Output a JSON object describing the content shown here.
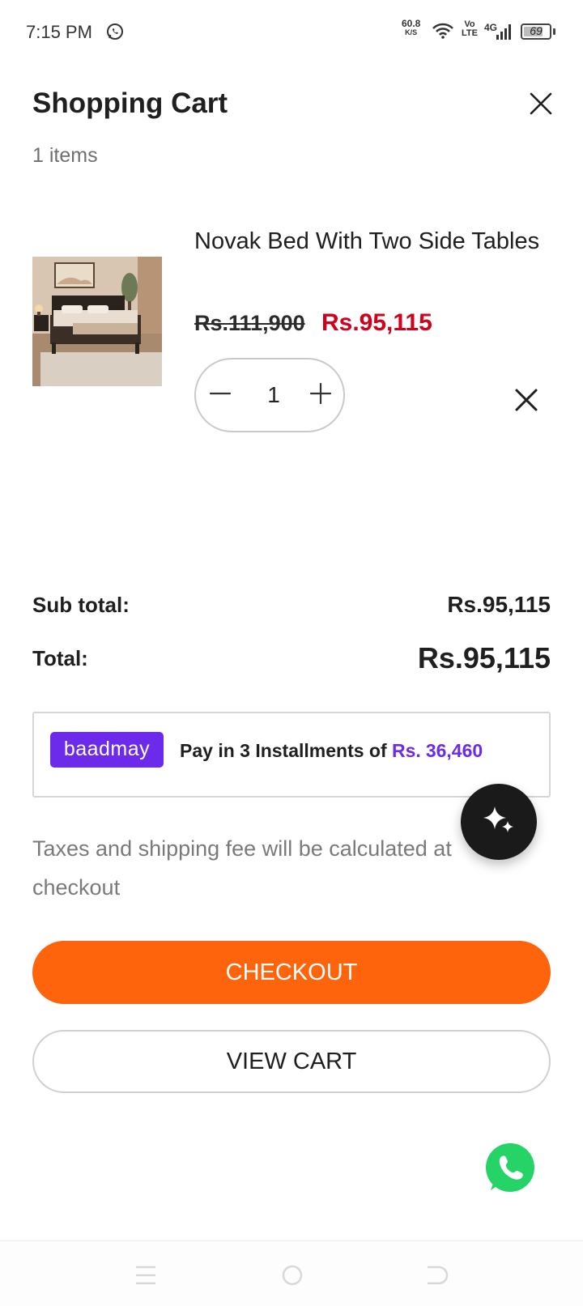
{
  "status_bar": {
    "time": "7:15 PM",
    "net_speed_value": "60.8",
    "net_speed_unit": "K/S",
    "volte_top": "Vo",
    "volte_bottom": "LTE",
    "network": "4G",
    "battery": "69"
  },
  "header": {
    "title": "Shopping Cart",
    "item_count": "1 items"
  },
  "cart_item": {
    "name": "Novak Bed With Two Side Tables",
    "original_price": "Rs.111,900",
    "sale_price": "Rs.95,115",
    "quantity": "1"
  },
  "summary": {
    "subtotal_label": "Sub total:",
    "subtotal_value": "Rs.95,115",
    "total_label": "Total:",
    "total_value": "Rs.95,115"
  },
  "installments": {
    "provider": "baadmay",
    "text": "Pay in 3 Installments of",
    "currency": "Rs.",
    "amount": "36,460"
  },
  "note": "Taxes and shipping fee will be calculated at checkout",
  "buttons": {
    "checkout": "CHECKOUT",
    "view_cart": "VIEW CART"
  },
  "colors": {
    "accent": "#fe640b",
    "sale_price": "#d0021b",
    "baadmay": "#6c2bea",
    "whatsapp": "#25d366"
  },
  "icons": {
    "close": "close-icon",
    "minus": "minus-icon",
    "plus": "plus-icon",
    "remove": "remove-icon",
    "ai": "sparkle-icon",
    "whatsapp": "whatsapp-icon"
  }
}
